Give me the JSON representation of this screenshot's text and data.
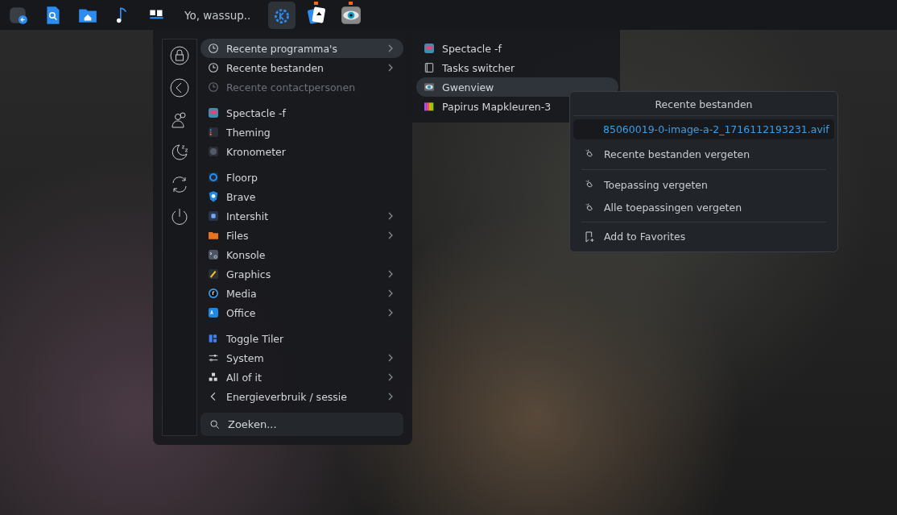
{
  "taskbar": {
    "launchers": [
      {
        "kind": "back"
      },
      {
        "kind": "search"
      },
      {
        "kind": "home"
      },
      {
        "kind": "music"
      },
      {
        "kind": "tiles"
      }
    ],
    "greeting": "Yo, wassup..",
    "tasks": [
      {
        "selected": true,
        "attention": false
      },
      {
        "selected": false,
        "attention": true
      },
      {
        "selected": false,
        "attention": true
      }
    ]
  },
  "menu": {
    "groups": [
      [
        {
          "label": "Recente programma's",
          "submenu": true,
          "disabled": false,
          "selected": true
        },
        {
          "label": "Recente bestanden",
          "submenu": true,
          "disabled": false,
          "selected": false
        },
        {
          "label": "Recente contactpersonen",
          "submenu": false,
          "disabled": true,
          "selected": false
        }
      ],
      [
        {
          "label": "Spectacle -f",
          "submenu": false,
          "disabled": false,
          "selected": false
        },
        {
          "label": "Theming",
          "submenu": false,
          "disabled": false,
          "selected": false
        },
        {
          "label": "Kronometer",
          "submenu": false,
          "disabled": false,
          "selected": false
        }
      ],
      [
        {
          "label": "Floorp",
          "submenu": false,
          "disabled": false,
          "selected": false
        },
        {
          "label": "Brave",
          "submenu": false,
          "disabled": false,
          "selected": false
        },
        {
          "label": "Intershit",
          "submenu": true,
          "disabled": false,
          "selected": false
        },
        {
          "label": "Files",
          "submenu": true,
          "disabled": false,
          "selected": false
        },
        {
          "label": "Konsole",
          "submenu": false,
          "disabled": false,
          "selected": false
        },
        {
          "label": "Graphics",
          "submenu": true,
          "disabled": false,
          "selected": false
        },
        {
          "label": "Media",
          "submenu": true,
          "disabled": false,
          "selected": false
        },
        {
          "label": "Office",
          "submenu": true,
          "disabled": false,
          "selected": false
        }
      ],
      [
        {
          "label": "Toggle Tiler",
          "submenu": false,
          "disabled": false,
          "selected": false
        },
        {
          "label": "System",
          "submenu": true,
          "disabled": false,
          "selected": false
        },
        {
          "label": "All of it",
          "submenu": true,
          "disabled": false,
          "selected": false
        },
        {
          "label": "Energieverbruik / sessie",
          "submenu": true,
          "disabled": false,
          "selected": false
        }
      ]
    ],
    "search": {
      "placeholder": "Zoeken..."
    }
  },
  "submenu": {
    "items": [
      {
        "label": "Spectacle -f",
        "selected": false
      },
      {
        "label": "Tasks switcher",
        "selected": false
      },
      {
        "label": "Gwenview",
        "selected": true
      },
      {
        "label": "Papirus Mapkleuren-3",
        "selected": false
      }
    ]
  },
  "context_menu": {
    "title": "Recente bestanden",
    "file": "85060019-0-image-a-2_1716112193231.avif",
    "sections": [
      [
        "Recente bestanden vergeten"
      ],
      [
        "Toepassing vergeten",
        "Alle toepassingen vergeten"
      ]
    ],
    "favorite": "Add to Favorites"
  }
}
